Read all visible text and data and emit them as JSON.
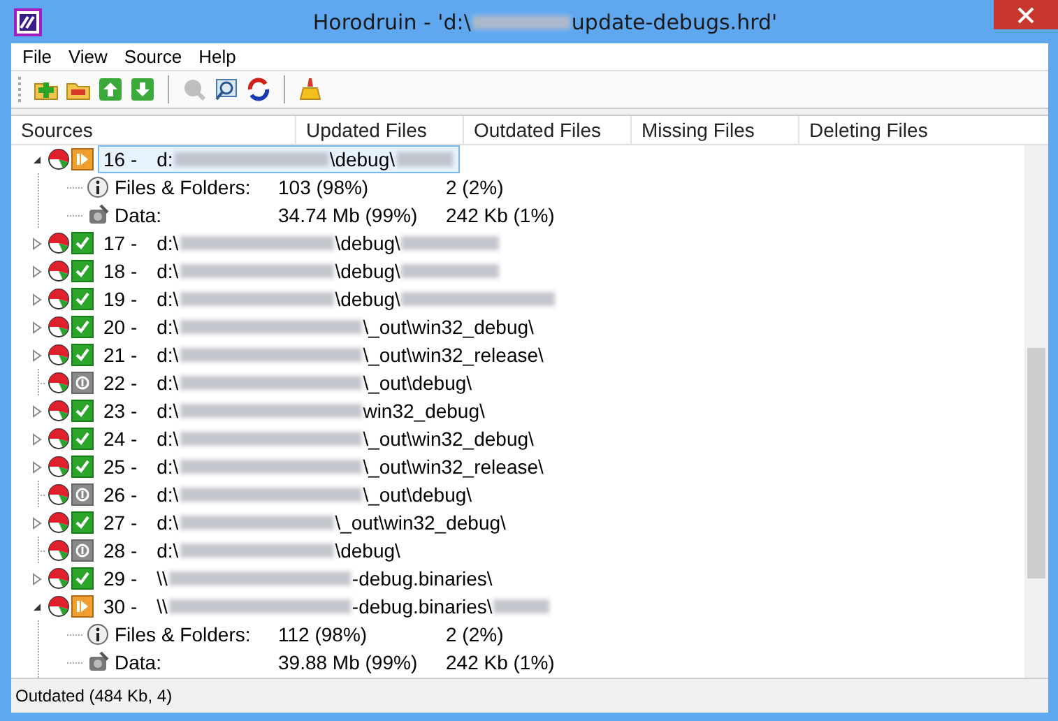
{
  "window": {
    "title": [
      {
        "kind": "text",
        "text": "Horodruin - 'd:\\"
      },
      {
        "kind": "blur-medium"
      },
      {
        "kind": "text",
        "text": "update-debugs.hrd'"
      }
    ]
  },
  "menu": [
    {
      "label": "File"
    },
    {
      "label": "View"
    },
    {
      "label": "Source"
    },
    {
      "label": "Help"
    }
  ],
  "toolbar": [
    {
      "kind": "add-folder",
      "disabled": false
    },
    {
      "kind": "remove-folder",
      "disabled": false
    },
    {
      "kind": "move-up",
      "disabled": false
    },
    {
      "kind": "move-down",
      "disabled": false
    },
    {
      "kind": "separator"
    },
    {
      "kind": "magnifier",
      "disabled": true
    },
    {
      "kind": "preview",
      "disabled": false
    },
    {
      "kind": "refresh",
      "disabled": false
    },
    {
      "kind": "separator"
    },
    {
      "kind": "broom",
      "disabled": false
    }
  ],
  "table": {
    "columns": [
      "Sources",
      "Updated Files",
      "Outdated Files",
      "Missing Files",
      "Deleting Files"
    ],
    "rows": [
      {
        "number": "16 -",
        "kind": "partial",
        "expanded": true,
        "selected": true,
        "path": [
          {
            "kind": "text",
            "text": "d:"
          },
          {
            "kind": "blur-long"
          },
          {
            "kind": "text",
            "text": "\\debug\\"
          },
          {
            "kind": "blur-short"
          }
        ],
        "children": [
          {
            "kind": "info",
            "label": "Files & Folders:",
            "updated": "103 (98%)",
            "outdated": "2 (2%)"
          },
          {
            "kind": "data",
            "label": "Data:",
            "updated": "34.74 Mb (99%)",
            "outdated": "242 Kb (1%)"
          }
        ]
      },
      {
        "number": "17 -",
        "kind": "ok",
        "expanded": false,
        "selected": false,
        "path": [
          {
            "kind": "text",
            "text": "d:\\"
          },
          {
            "kind": "blur-long"
          },
          {
            "kind": "text",
            "text": "\\debug\\"
          },
          {
            "kind": "blur-medium"
          }
        ]
      },
      {
        "number": "18 -",
        "kind": "ok",
        "expanded": false,
        "selected": false,
        "path": [
          {
            "kind": "text",
            "text": "d:\\"
          },
          {
            "kind": "blur-long"
          },
          {
            "kind": "text",
            "text": "\\debug\\"
          },
          {
            "kind": "blur-medium"
          }
        ]
      },
      {
        "number": "19 -",
        "kind": "ok",
        "expanded": false,
        "selected": false,
        "path": [
          {
            "kind": "text",
            "text": "d:\\"
          },
          {
            "kind": "blur-long"
          },
          {
            "kind": "text",
            "text": "\\debug\\"
          },
          {
            "kind": "blur-long"
          }
        ]
      },
      {
        "number": "20 -",
        "kind": "ok",
        "expanded": false,
        "selected": false,
        "path": [
          {
            "kind": "text",
            "text": "d:\\"
          },
          {
            "kind": "blur-xlong"
          },
          {
            "kind": "text",
            "text": "\\_out\\win32_debug\\"
          }
        ]
      },
      {
        "number": "21 -",
        "kind": "ok",
        "expanded": false,
        "selected": false,
        "path": [
          {
            "kind": "text",
            "text": "d:\\"
          },
          {
            "kind": "blur-xlong"
          },
          {
            "kind": "text",
            "text": "\\_out\\win32_release\\"
          }
        ]
      },
      {
        "number": "22 -",
        "kind": "idle",
        "selected": false,
        "path": [
          {
            "kind": "text",
            "text": "d:\\"
          },
          {
            "kind": "blur-xlong"
          },
          {
            "kind": "text",
            "text": "\\_out\\debug\\"
          }
        ]
      },
      {
        "number": "23 -",
        "kind": "ok",
        "expanded": false,
        "selected": false,
        "path": [
          {
            "kind": "text",
            "text": "d:\\"
          },
          {
            "kind": "blur-xlong"
          },
          {
            "kind": "text",
            "text": "win32_debug\\"
          }
        ]
      },
      {
        "number": "24 -",
        "kind": "ok",
        "expanded": false,
        "selected": false,
        "path": [
          {
            "kind": "text",
            "text": "d:\\"
          },
          {
            "kind": "blur-xlong"
          },
          {
            "kind": "text",
            "text": "\\_out\\win32_debug\\"
          }
        ]
      },
      {
        "number": "25 -",
        "kind": "ok",
        "expanded": false,
        "selected": false,
        "path": [
          {
            "kind": "text",
            "text": "d:\\"
          },
          {
            "kind": "blur-xlong"
          },
          {
            "kind": "text",
            "text": "\\_out\\win32_release\\"
          }
        ]
      },
      {
        "number": "26 -",
        "kind": "idle",
        "selected": false,
        "path": [
          {
            "kind": "text",
            "text": "d:\\"
          },
          {
            "kind": "blur-xlong"
          },
          {
            "kind": "text",
            "text": "\\_out\\debug\\"
          }
        ]
      },
      {
        "number": "27 -",
        "kind": "ok",
        "expanded": false,
        "selected": false,
        "path": [
          {
            "kind": "text",
            "text": "d:\\"
          },
          {
            "kind": "blur-long"
          },
          {
            "kind": "text",
            "text": "\\_out\\win32_debug\\"
          }
        ]
      },
      {
        "number": "28 -",
        "kind": "idle",
        "selected": false,
        "path": [
          {
            "kind": "text",
            "text": "d:\\"
          },
          {
            "kind": "blur-long"
          },
          {
            "kind": "text",
            "text": "\\debug\\"
          }
        ]
      },
      {
        "number": "29 -",
        "kind": "ok",
        "expanded": false,
        "selected": false,
        "path": [
          {
            "kind": "text",
            "text": "\\\\"
          },
          {
            "kind": "blur-xlong"
          },
          {
            "kind": "text",
            "text": "-debug.binaries\\"
          }
        ]
      },
      {
        "number": "30 -",
        "kind": "partial",
        "expanded": true,
        "selected": false,
        "path": [
          {
            "kind": "text",
            "text": "\\\\"
          },
          {
            "kind": "blur-xlong"
          },
          {
            "kind": "text",
            "text": "-debug.binaries\\"
          },
          {
            "kind": "blur-short"
          }
        ],
        "children": [
          {
            "kind": "info",
            "label": "Files & Folders:",
            "updated": "112 (98%)",
            "outdated": "2 (2%)"
          },
          {
            "kind": "data",
            "label": "Data:",
            "updated": "39.88 Mb (99%)",
            "outdated": "242 Kb (1%)"
          }
        ]
      }
    ]
  },
  "status_bar": "Outdated (484 Kb, 4)"
}
